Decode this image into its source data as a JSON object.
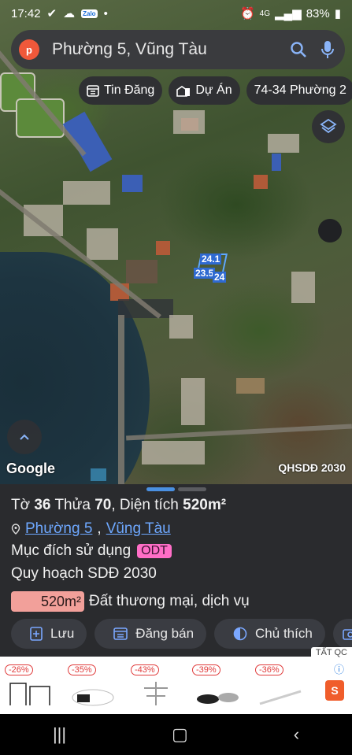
{
  "status": {
    "time": "17:42",
    "battery": "83%",
    "zalo_label": "Zalo",
    "network": "4G"
  },
  "search": {
    "avatar_letter": "p",
    "query": "Phường 5, Vũng Tàu"
  },
  "chips": [
    {
      "label": "Tin Đăng",
      "icon": "calendar-icon"
    },
    {
      "label": "Dự Án",
      "icon": "buildings-icon"
    },
    {
      "label": "74-34 Phường 2",
      "icon": ""
    }
  ],
  "map": {
    "dims": [
      "24.1",
      "23.5",
      "24"
    ],
    "attribution": "Google",
    "layer_label": "QHSDĐ 2030"
  },
  "panel": {
    "title_prefix": "Tờ",
    "sheet": "36",
    "parcel_prefix": "Thửa",
    "parcel": "70",
    "area_prefix": ", Diện tích",
    "area": "520m²",
    "ward": "Phường 5",
    "city": "Vũng Tàu",
    "purpose_label": "Mục đích sử dụng",
    "purpose_code": "ODT",
    "plan_label": "Quy hoạch SDĐ 2030",
    "plan_area": "520m²",
    "plan_use": "Đất thương mại, dịch vụ",
    "actions": [
      {
        "label": "Lưu",
        "icon": "save-icon"
      },
      {
        "label": "Đăng bán",
        "icon": "listing-icon"
      },
      {
        "label": "Chủ thích",
        "icon": "contrast-icon"
      }
    ]
  },
  "ad": {
    "tag": "TẤT QC",
    "discounts": [
      "-26%",
      "-35%",
      "-43%",
      "-39%",
      "-36%"
    ]
  },
  "colors": {
    "accent": "#4a90e2",
    "odt": "#ff6ec7",
    "area_badge": "#f2a09a"
  }
}
